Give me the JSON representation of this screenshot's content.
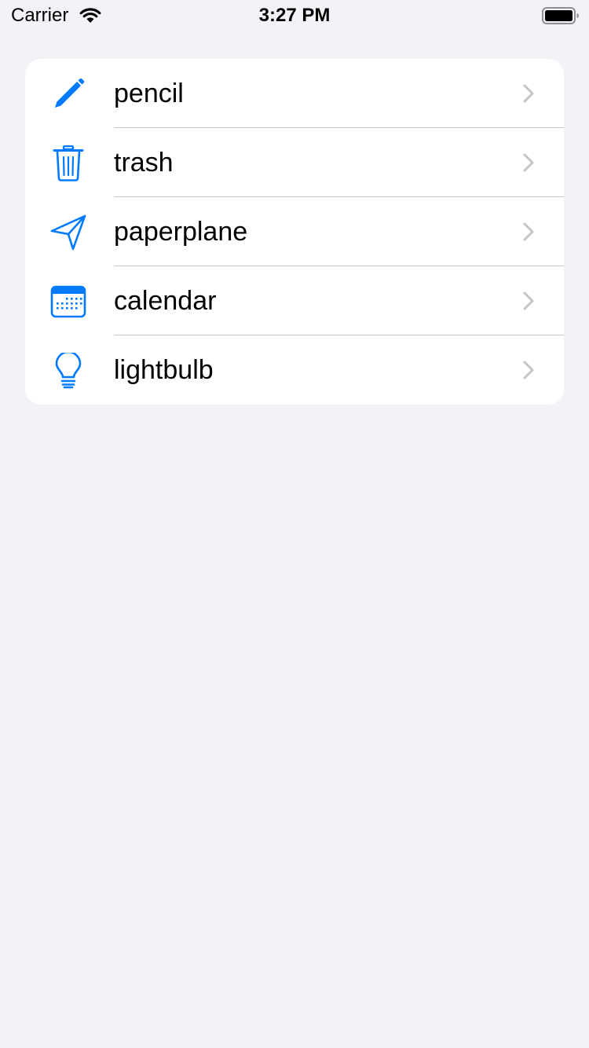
{
  "status_bar": {
    "carrier": "Carrier",
    "time": "3:27 PM",
    "wifi_icon": "wifi-icon",
    "battery_icon": "battery-icon"
  },
  "list": {
    "accent_color": "#007aff",
    "chevron_color": "#c4c4c7",
    "items": [
      {
        "label": "pencil",
        "icon": "pencil-icon"
      },
      {
        "label": "trash",
        "icon": "trash-icon"
      },
      {
        "label": "paperplane",
        "icon": "paperplane-icon"
      },
      {
        "label": "calendar",
        "icon": "calendar-icon"
      },
      {
        "label": "lightbulb",
        "icon": "lightbulb-icon"
      }
    ]
  }
}
